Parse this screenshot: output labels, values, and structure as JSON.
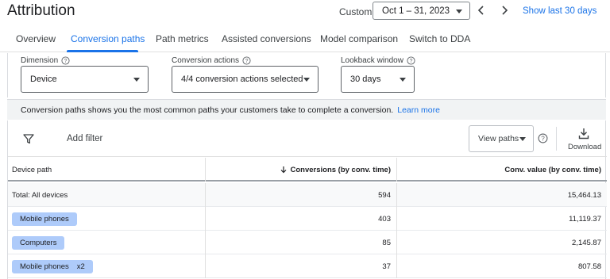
{
  "header": {
    "title": "Attribution",
    "range_label": "Custom",
    "date_range": "Oct 1 – 31, 2023",
    "show_last": "Show last 30 days"
  },
  "tabs": [
    {
      "label": "Overview"
    },
    {
      "label": "Conversion paths",
      "active": true
    },
    {
      "label": "Path metrics"
    },
    {
      "label": "Assisted conversions"
    },
    {
      "label": "Model comparison"
    },
    {
      "label": "Switch to DDA"
    }
  ],
  "filters": {
    "dimension": {
      "label": "Dimension",
      "value": "Device"
    },
    "conversion_actions": {
      "label": "Conversion actions",
      "value": "4/4 conversion actions selected"
    },
    "lookback": {
      "label": "Lookback window",
      "value": "30 days"
    }
  },
  "notice": {
    "text": "Conversion paths shows you the most common paths your customers take to complete a conversion.",
    "link": "Learn more"
  },
  "toolbar": {
    "add_filter": "Add filter",
    "view_paths": "View paths",
    "download": "Download"
  },
  "table": {
    "columns": [
      "Device path",
      "Conversions (by conv. time)",
      "Conv. value (by conv. time)"
    ],
    "total": {
      "label": "Total: All devices",
      "conversions": "594",
      "value": "15,464.13"
    },
    "rows": [
      {
        "path": "Mobile phones",
        "mult": "",
        "conversions": "403",
        "value": "11,119.37"
      },
      {
        "path": "Computers",
        "mult": "",
        "conversions": "85",
        "value": "2,145.87"
      },
      {
        "path": "Mobile phones",
        "mult": "x2",
        "conversions": "37",
        "value": "807.58"
      }
    ]
  },
  "colors": {
    "accent": "#1a73e8",
    "chip": "#aecbfa",
    "notice_bg": "#f1f3f4"
  },
  "icons": [
    "chevron-left-icon",
    "chevron-right-icon",
    "help-icon",
    "filter-icon",
    "download-icon",
    "sort-down-icon"
  ]
}
